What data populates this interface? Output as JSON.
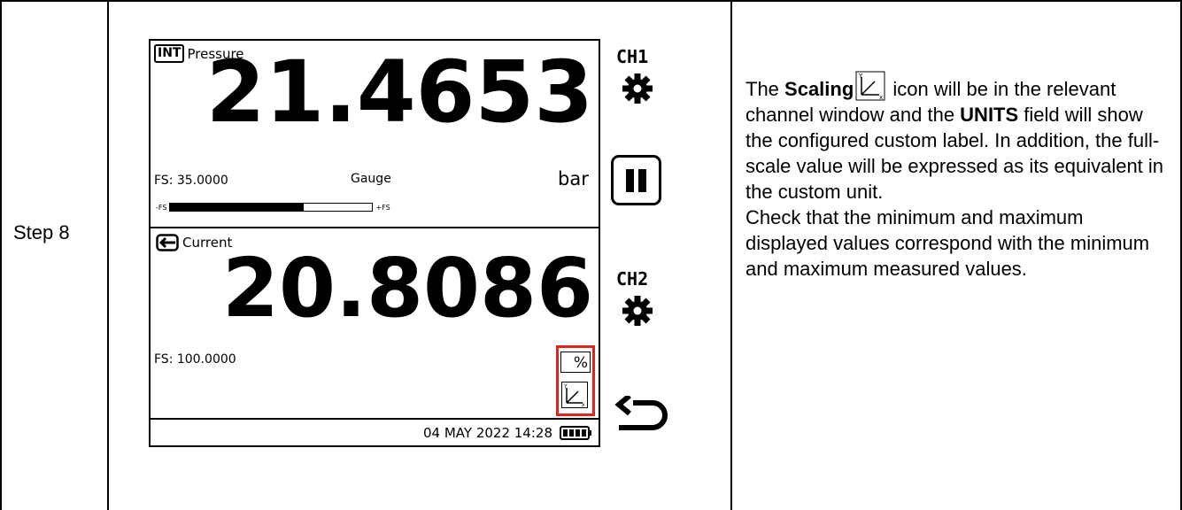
{
  "step_label": "Step 8",
  "screen": {
    "ch1": {
      "badge": "INT",
      "name": "Pressure",
      "reading": "21.4653",
      "fs": "FS: 35.0000",
      "mode": "Gauge",
      "unit": "bar",
      "bar_min": "-FS",
      "bar_max": "+FS",
      "bar_fill_fraction": 0.66
    },
    "ch2": {
      "name": "Current",
      "reading": "20.8086",
      "fs": "FS: 100.0000",
      "unit": "%"
    },
    "status": {
      "datetime": "04 MAY 2022 14:28"
    }
  },
  "side": {
    "ch1_label": "CH1",
    "ch2_label": "CH2"
  },
  "description": {
    "p1_a": "The ",
    "p1_b": "Scaling",
    "p1_c": " icon will be in the relevant channel window and the ",
    "p1_d": "UNITS",
    "p1_e": " field will show the configured custom label. In addition, the full-scale value will be expressed as its equivalent in the custom unit.",
    "p2": "Check that the minimum and maximum displayed values correspond with the minimum and maximum measured values."
  },
  "colors": {
    "highlight": "#e2231a"
  }
}
